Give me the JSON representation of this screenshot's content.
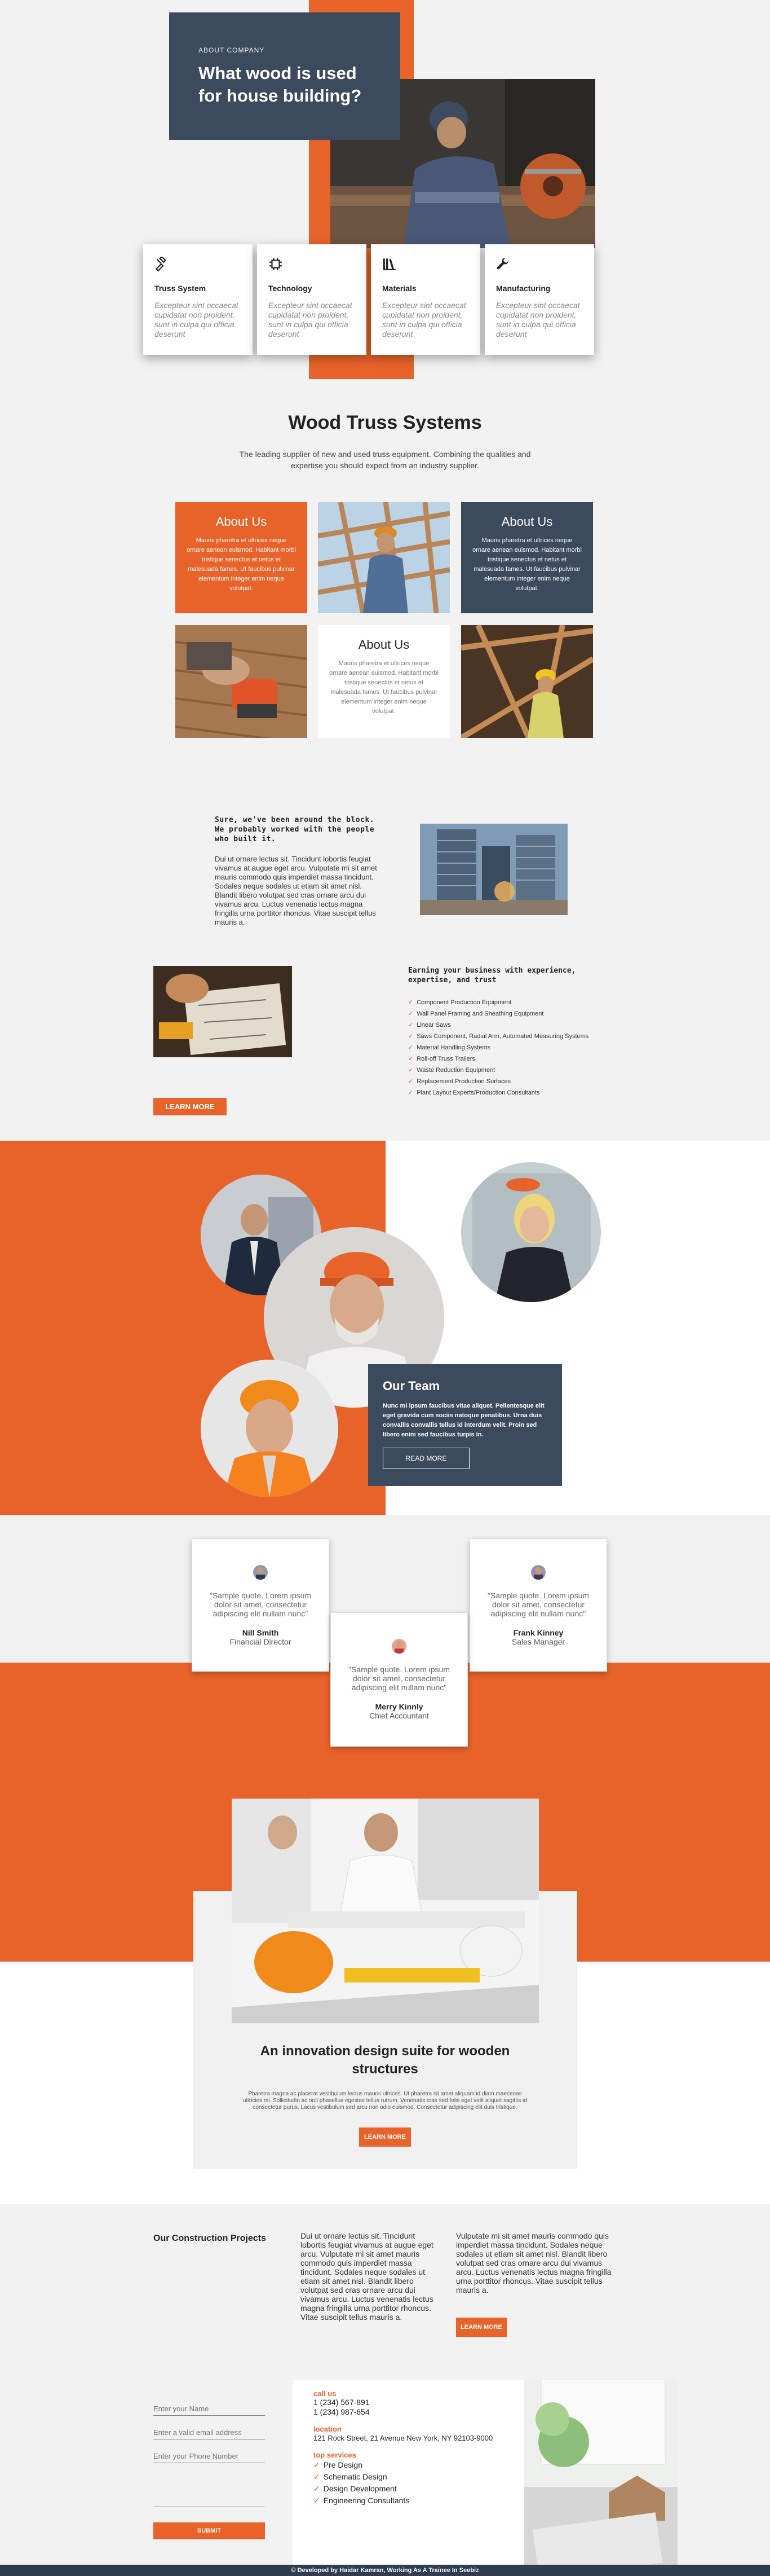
{
  "hero": {
    "eyebrow": "ABOUT COMPANY",
    "title": "What wood is used for house building?",
    "cards": [
      {
        "icon": "hammer-icon",
        "title": "Truss System",
        "text": "Excepteur sint occaecat cupidatat non proident, sunt in culpa qui officia deserunt"
      },
      {
        "icon": "chip-icon",
        "title": "Technology",
        "text": "Excepteur sint occaecat cupidatat non proident, sunt in culpa qui officia deserunt"
      },
      {
        "icon": "books-icon",
        "title": "Materials",
        "text": "Excepteur sint occaecat cupidatat non proident, sunt in culpa qui officia deserunt"
      },
      {
        "icon": "wrench-icon",
        "title": "Manufacturing",
        "text": "Excepteur sint occaecat cupidatat non proident, sunt in culpa qui officia deserunt"
      }
    ]
  },
  "truss": {
    "title": "Wood Truss Systems",
    "subtitle": "The leading supplier of new and used truss equipment. Combining the qualities and expertise you should expect from an industry supplier.",
    "tiles": [
      {
        "heading": "About Us",
        "text": "Mauris pharetra et ultrices neque ornare aenean euismod. Habitant morbi tristique senectus et netus et malesuada fames. Ut faucibus pulvinar elementum integer enim neque volutpat."
      },
      {
        "heading": "About Us",
        "text": "Mauris pharetra et ultrices neque ornare aenean euismod. Habitant morbi tristique senectus et netus et malesuada fames. Ut faucibus pulvinar elementum integer enim neque volutpat."
      },
      {
        "heading": "About Us",
        "text": "Mauris pharetra et ultrices neque ornare aenean euismod. Habitant morbi tristique senectus et netus et malesuada fames. Ut faucibus pulvinar elementum integer enim neque volutpat."
      }
    ]
  },
  "block": {
    "heading": "Sure, we've been around the block. We probably worked with the people who built it.",
    "text": "Dui ut ornare lectus sit. Tincidunt lobortis feugiat vivamus at augue eget arcu. Vulputate mi sit amet mauris commodo quis imperdiet massa tincidunt. Sodales neque sodales ut etiam sit amet nisl. Blandit libero volutpat sed cras ornare arcu dui vivamus arcu. Luctus venenatis lectus magna fringilla urna porttitor rhoncus. Vitae suscipit tellus mauris a."
  },
  "earning": {
    "heading": "Earning your business with experience, expertise, and trust",
    "items": [
      "Component Production Equipment",
      "Wall Panel Framing and Sheathing Equipment",
      "Linear Saws",
      "Saws Component, Radial Arm, Automated Measuring Systems",
      "Material Handling Systems",
      "Roll-off Truss Trailers",
      "Waste Reduction Equipment",
      "Replacement Production Surfaces",
      "Plant Layout Experts/Production Consultants"
    ],
    "button": "LEARN MORE"
  },
  "team": {
    "title": "Our Team",
    "text": "Nunc mi ipsum faucibus vitae aliquet. Pellentesque elit eget gravida cum sociis natoque penatibus. Urna duis convallis convallis tellus id interdum velit. Proin sed libero enim sed faucibus turpis in.",
    "button": "READ MORE"
  },
  "testimonials": [
    {
      "quote": "\"Sample quote. Lorem ipsum dolor sit amet, consectetur adipiscing elit nullam nunc\"",
      "name": "Nill Smith",
      "role": "Financial Director"
    },
    {
      "quote": "\"Sample quote. Lorem ipsum dolor sit amet, consectetur adipiscing elit nullam nunc\"",
      "name": "Merry Kinnly",
      "role": "Chief Accountant"
    },
    {
      "quote": "\"Sample quote. Lorem ipsum dolor sit amet, consectetur adipiscing elit nullam nunc\"",
      "name": "Frank Kinney",
      "role": "Sales Manager"
    }
  ],
  "innovation": {
    "title": "An innovation design suite for wooden structures",
    "text": "Pharetra magna ac placerat vestibulum lectus mauris ultrices. Ut pharetra sit amet aliquam id diam maecenas ultricies mi. Sollicitudin ac orci phasellus egestas tellus rutrum. Venenatis cras sed felis eget velit aliquet sagittis id consectetur purus. Lacus vestibulum sed arcu non odio euismod. Consectetur adipiscing elit duis tristique.",
    "button": "LEARN MORE"
  },
  "projects": {
    "title": "Our Construction Projects",
    "col1": "Dui ut ornare lectus sit. Tincidunt lobortis feugiat vivamus at augue eget arcu. Vulputate mi sit amet mauris commodo quis imperdiet massa tincidunt. Sodales neque sodales ut etiam sit amet nisl. Blandit libero volutpat sed cras ornare arcu dui vivamus arcu. Luctus venenatis lectus magna fringilla urna porttitor rhoncus. Vitae suscipit tellus mauris a.",
    "col2": "Vulputate mi sit amet mauris commodo quis imperdiet massa tincidunt. Sodales neque sodales ut etiam sit amet nisl. Blandit libero volutpat sed cras ornare arcu dui vivamus arcu. Luctus venenatis lectus magna fringilla urna porttitor rhoncus. Vitae suscipit tellus mauris a.",
    "button": "LEARN MORE"
  },
  "contact": {
    "name_placeholder": "Enter your Name",
    "email_placeholder": "Enter a valid email address",
    "phone_placeholder": "Enter your Phone Number",
    "submit": "SUBMIT",
    "call_label": "call us",
    "phone1": "1 (234) 567-891",
    "phone2": "1 (234) 987-654",
    "location_label": "location",
    "address": "121 Rock Street, 21 Avenue New York, NY 92103-9000",
    "services_label": "top services",
    "services": [
      "Pre Design",
      "Schematic Design",
      "Design Development",
      "Engineering Consultants"
    ]
  },
  "footer": {
    "text": "© Developed by Haidar Kamran, Working As A Trainee In Seebiz"
  },
  "colors": {
    "accent": "#e8632a",
    "navy": "#3c4a5e"
  }
}
